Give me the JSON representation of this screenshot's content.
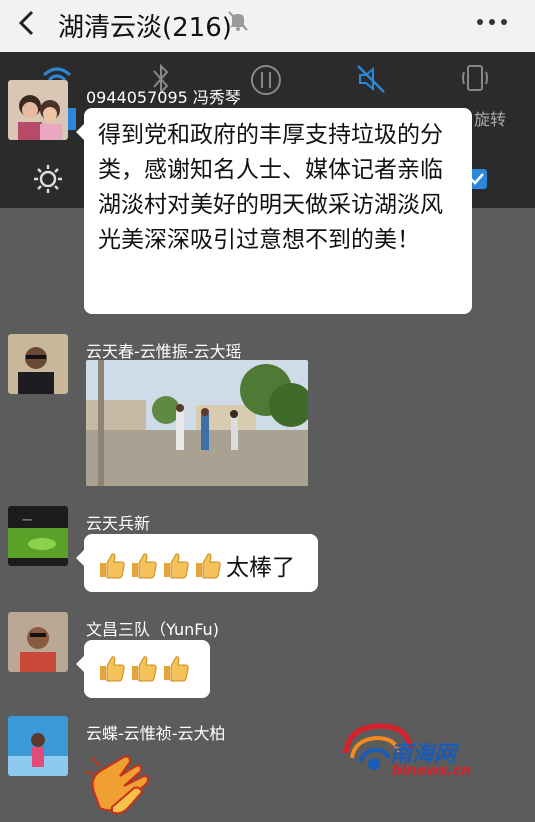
{
  "header": {
    "title": "湖清云淡(216)"
  },
  "quick_settings": {
    "rotate_label": "旋转"
  },
  "messages": [
    {
      "sender": "0944057095 冯秀琴",
      "text": "得到党和政府的丰厚支持垃圾的分类，感谢知名人士、媒体记者亲临湖淡村对美好的明天做采访湖淡风光美深深吸引过意想不到的美！"
    },
    {
      "sender": "云天春-云惟振-云大瑶"
    },
    {
      "sender": "云天兵新",
      "text": "太棒了",
      "thumbs_count": 4
    },
    {
      "sender": "文昌三队（YunFu)",
      "thumbs_count": 3
    },
    {
      "sender": "云蝶-云惟祯-云大柏"
    }
  ],
  "watermark": {
    "text": "南海网",
    "sub": "hinews.cn"
  },
  "icons": [
    "back-arrow-icon",
    "mute-bell-icon",
    "more-dots-icon",
    "wifi-icon",
    "bluetooth-icon",
    "data-icon",
    "mute-icon",
    "rotate-icon",
    "brightness-icon",
    "thumbs-up-icon",
    "clapping-hands-icon"
  ]
}
